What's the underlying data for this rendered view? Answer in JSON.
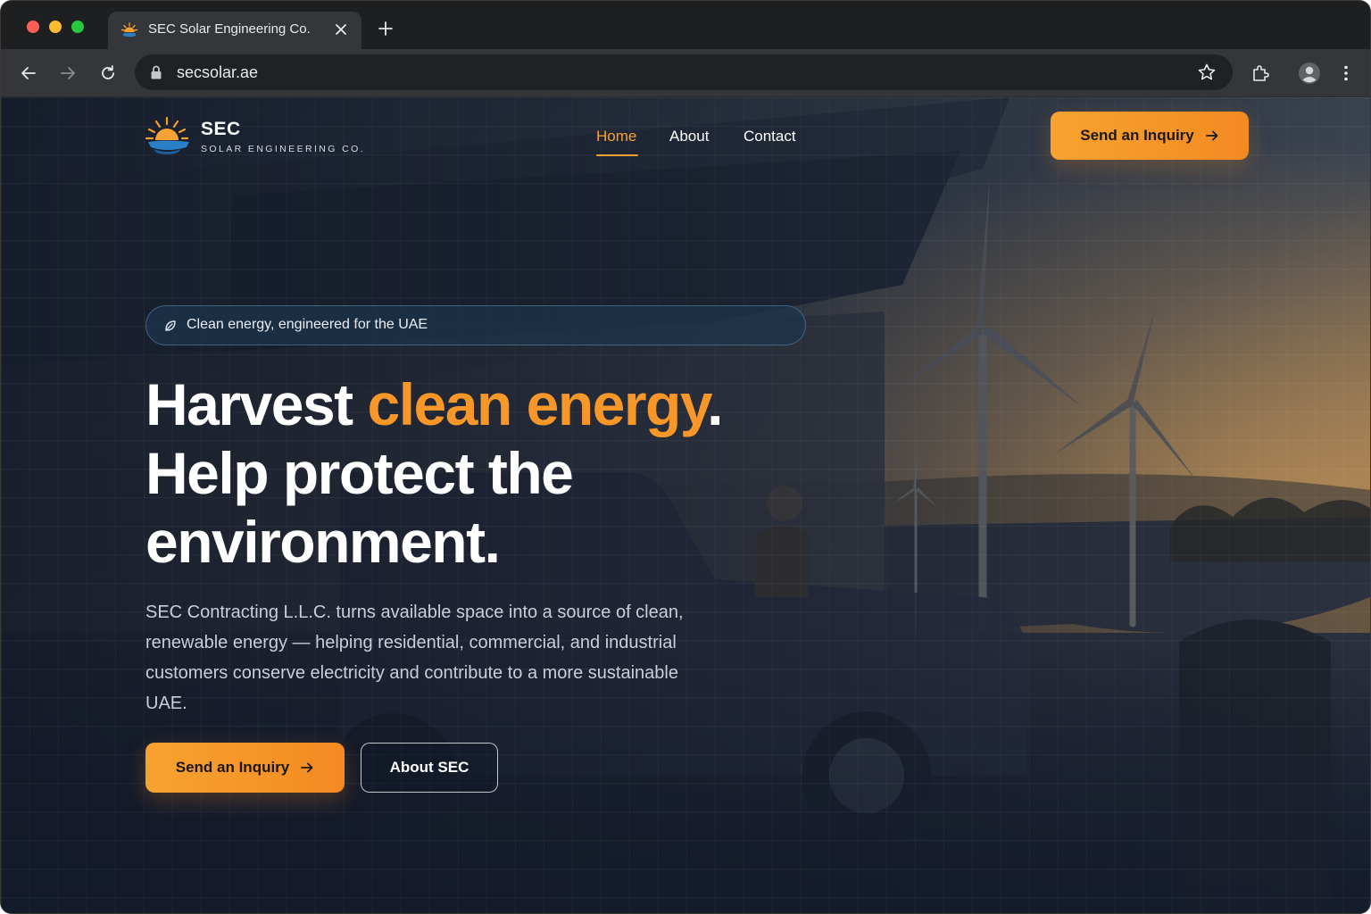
{
  "browser": {
    "tab_title": "SEC Solar Engineering Co.",
    "url": "secsolar.ae"
  },
  "nav": {
    "logo_title": "SEC",
    "logo_subtitle": "SOLAR ENGINEERING CO.",
    "links": [
      {
        "label": "Home",
        "active": true
      },
      {
        "label": "About",
        "active": false
      },
      {
        "label": "Contact",
        "active": false
      }
    ],
    "cta_label": "Send an Inquiry"
  },
  "hero": {
    "pill_text": "Clean energy, engineered for the UAE",
    "headline_part1": "Harvest ",
    "headline_accent": "clean energy",
    "headline_part2": ".",
    "headline_line2": "Help protect the environment.",
    "body": "SEC Contracting L.L.C. turns available space into a source of clean, renewable energy — helping residential, commercial, and industrial customers conserve electricity and contribute to a more sustainable UAE.",
    "primary_cta": "Send an Inquiry",
    "secondary_cta": "About SEC"
  },
  "colors": {
    "accent": "#f7972a",
    "background": "#1b2231",
    "pill": "#1c344e"
  },
  "icons": [
    "sun-logo-icon",
    "leaf-icon",
    "arrow-right-icon",
    "back-icon",
    "forward-icon",
    "reload-icon",
    "lock-icon",
    "star-icon",
    "extensions-icon",
    "profile-icon",
    "menu-icon",
    "close-icon",
    "plus-icon"
  ]
}
